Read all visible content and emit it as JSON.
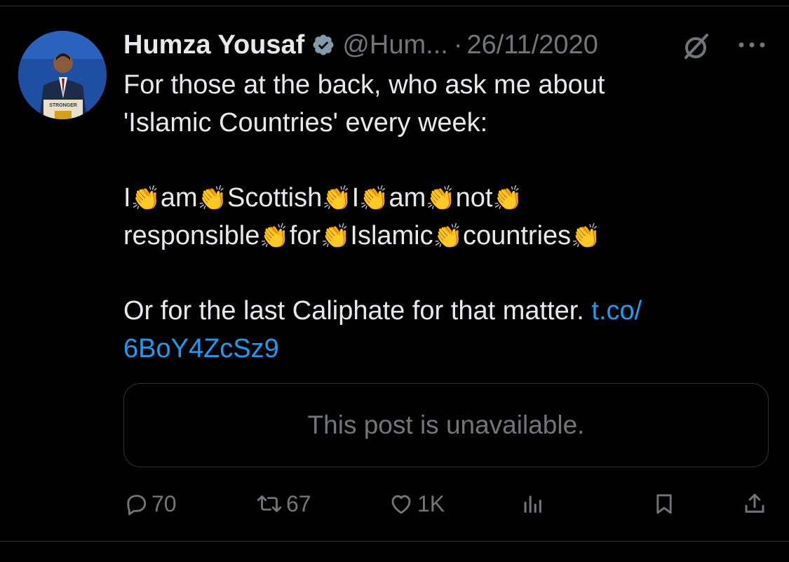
{
  "tweet": {
    "author": {
      "name": "Humza Yousaf",
      "handle": "@Hum...",
      "verified": true,
      "avatar_sign_text": "STRONGER"
    },
    "separator": "·",
    "date": "26/11/2020",
    "text": {
      "line1": "For those at the back, who ask me about",
      "line2": "'Islamic Countries' every week:",
      "clap_line1": [
        "I",
        "am",
        "Scottish",
        "I",
        "am",
        "not"
      ],
      "clap_line2": [
        "responsible",
        "for",
        "Islamic",
        "countries"
      ],
      "clap_emoji": "👏",
      "line3": "Or for the last Caliphate for that matter. ",
      "link_part1": "t.co/",
      "link_part2": "6BoY4ZcSz9"
    },
    "quoted_post": {
      "message": "This post is unavailable."
    },
    "actions": {
      "replies": "70",
      "reposts": "67",
      "likes": "1K"
    }
  },
  "icons": {
    "verified": "verified-badge-icon",
    "grok": "grok-icon",
    "more": "more-options-icon",
    "reply": "reply-icon",
    "repost": "repost-icon",
    "like": "heart-icon",
    "views": "analytics-icon",
    "bookmark": "bookmark-icon",
    "share": "share-icon"
  },
  "colors": {
    "background": "#000000",
    "text_primary": "#e7e9ea",
    "text_secondary": "#71767b",
    "link": "#1d9bf0",
    "border": "#2f3336"
  }
}
